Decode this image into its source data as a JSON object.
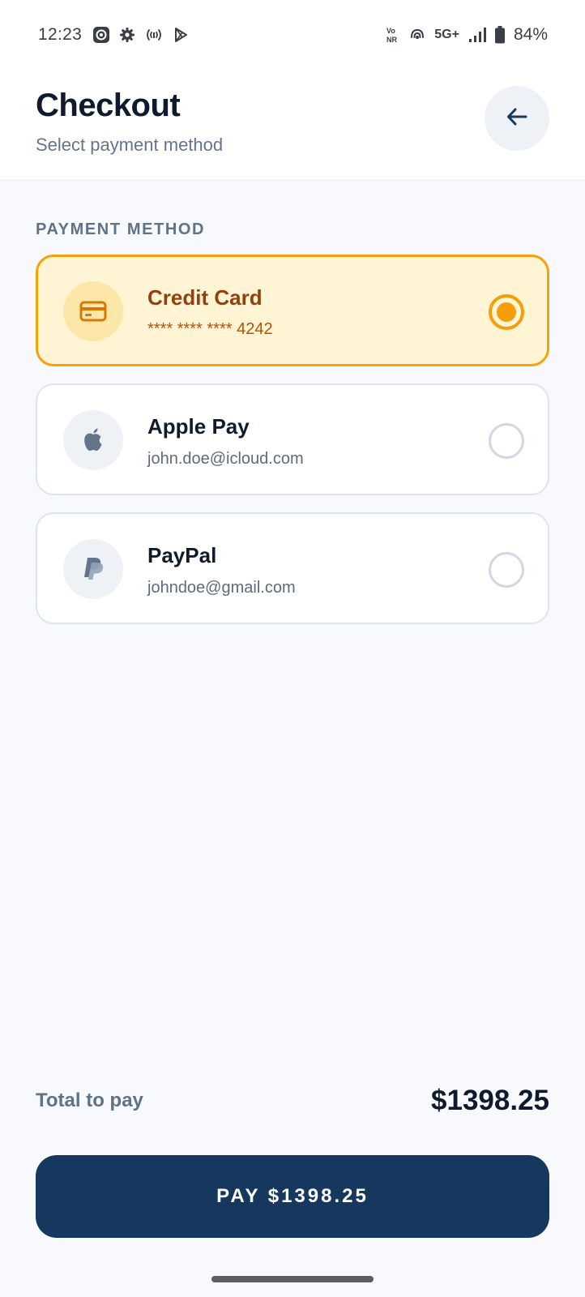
{
  "status_bar": {
    "time": "12:23",
    "network_tag": "Vo NR",
    "network_type": "5G+",
    "battery": "84%"
  },
  "header": {
    "title": "Checkout",
    "subtitle": "Select payment method",
    "back_icon": "arrow-left-icon"
  },
  "payment": {
    "section_label": "PAYMENT METHOD",
    "selected_index": 0,
    "options": [
      {
        "title": "Credit Card",
        "detail": "**** **** **** 4242",
        "icon": "credit-card-icon",
        "selected": true
      },
      {
        "title": "Apple Pay",
        "detail": "john.doe@icloud.com",
        "icon": "apple-icon",
        "selected": false
      },
      {
        "title": "PayPal",
        "detail": "johndoe@gmail.com",
        "icon": "paypal-icon",
        "selected": false
      }
    ]
  },
  "footer": {
    "total_label": "Total to pay",
    "total_value": "$1398.25",
    "pay_button_label": "PAY $1398.25"
  },
  "colors": {
    "accent": "#f59e0b",
    "selected_bg": "#fff4d3",
    "primary_button": "#16385e",
    "text_dark": "#0f1b2d",
    "text_muted": "#5f7287"
  }
}
